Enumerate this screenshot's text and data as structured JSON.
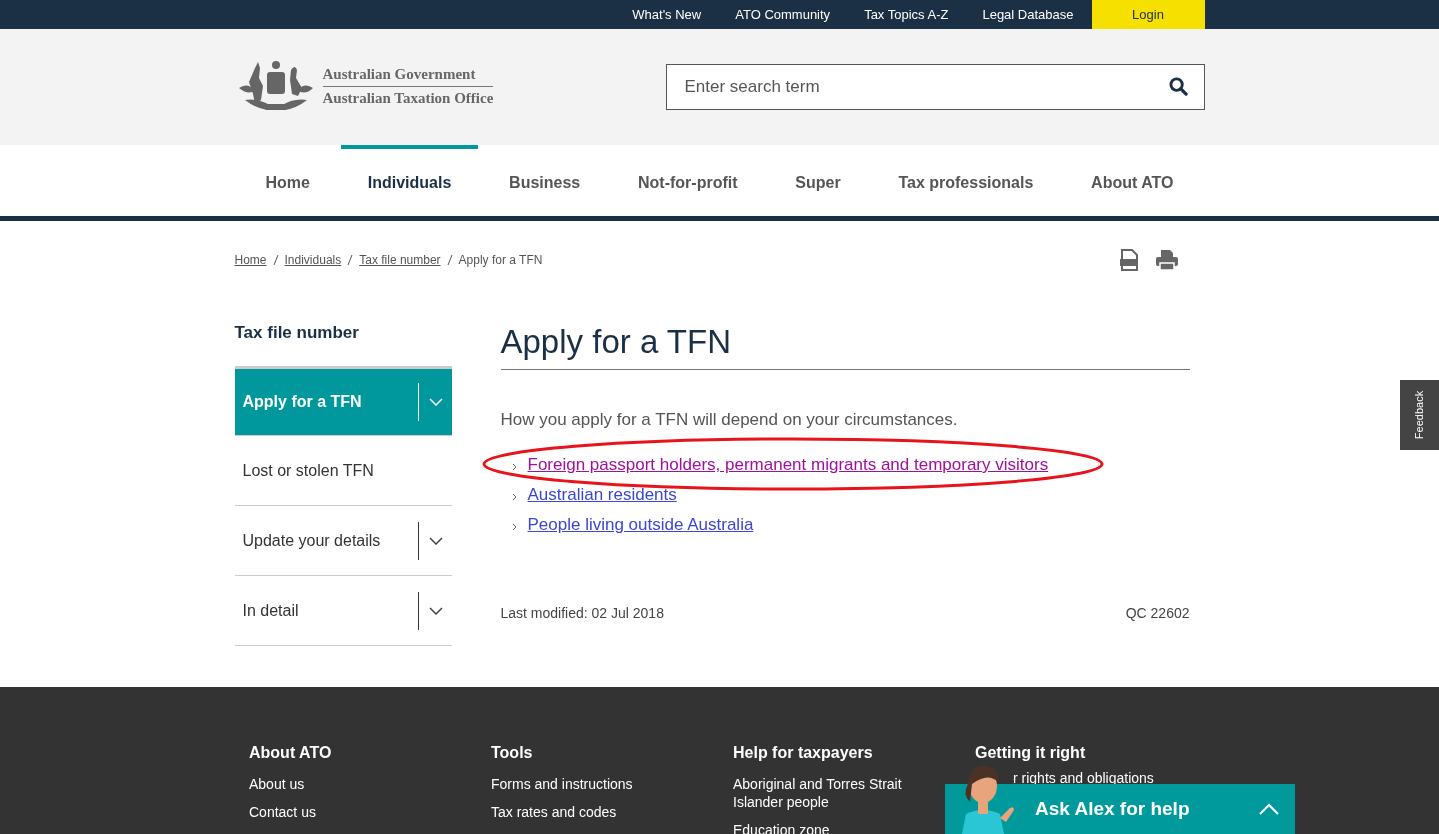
{
  "top_bar": {
    "links": [
      "What's New",
      "ATO Community",
      "Tax Topics A-Z",
      "Legal Database"
    ],
    "login": "Login"
  },
  "header": {
    "logo_line_1": "Australian Government",
    "logo_line_2": "Australian Taxation Office",
    "search": {
      "placeholder": "Enter search term"
    }
  },
  "nav": [
    {
      "label": "Home",
      "selected": false
    },
    {
      "label": "Individuals",
      "selected": true
    },
    {
      "label": "Business",
      "selected": false
    },
    {
      "label": "Not-for-profit",
      "selected": false
    },
    {
      "label": "Super",
      "selected": false
    },
    {
      "label": "Tax professionals",
      "selected": false
    },
    {
      "label": "About ATO",
      "selected": false
    }
  ],
  "breadcrumb": [
    {
      "label": "Home",
      "link": true
    },
    {
      "label": "Individuals",
      "link": true
    },
    {
      "label": "Tax file number",
      "link": true
    },
    {
      "label": "Apply for a TFN",
      "link": false
    }
  ],
  "sidebar": {
    "title": "Tax file number",
    "items": [
      {
        "label": "Apply for a TFN",
        "selected": true,
        "expandable": true
      },
      {
        "label": "Lost or stolen TFN",
        "selected": false,
        "expandable": false
      },
      {
        "label": "Update your details",
        "selected": false,
        "expandable": true
      },
      {
        "label": "In detail",
        "selected": false,
        "expandable": true
      }
    ]
  },
  "main": {
    "title": "Apply for a TFN",
    "intro": "How you apply for a TFN will depend on your circumstances.",
    "links": [
      {
        "label": "Foreign passport holders, permanent migrants and temporary visitors",
        "visited": true,
        "circled": true
      },
      {
        "label": "Australian residents",
        "visited": false,
        "circled": false
      },
      {
        "label": "People living outside Australia",
        "visited": false,
        "circled": false
      }
    ],
    "last_modified": "Last modified: 02 Jul 2018",
    "qc": "QC 22602"
  },
  "feedback": "Feedback",
  "footer": [
    {
      "heading": "About ATO",
      "links": [
        "About us",
        "Contact us"
      ]
    },
    {
      "heading": "Tools",
      "links": [
        "Forms and instructions",
        "Tax rates and codes"
      ]
    },
    {
      "heading": "Help for taxpayers",
      "links": [
        "Aboriginal and Torres Strait Islander people",
        "Education zone"
      ]
    },
    {
      "heading": "Getting it right",
      "links": [
        "r rights and obligations"
      ]
    }
  ],
  "chat": {
    "label": "Ask Alex for help",
    "expanded": false
  }
}
